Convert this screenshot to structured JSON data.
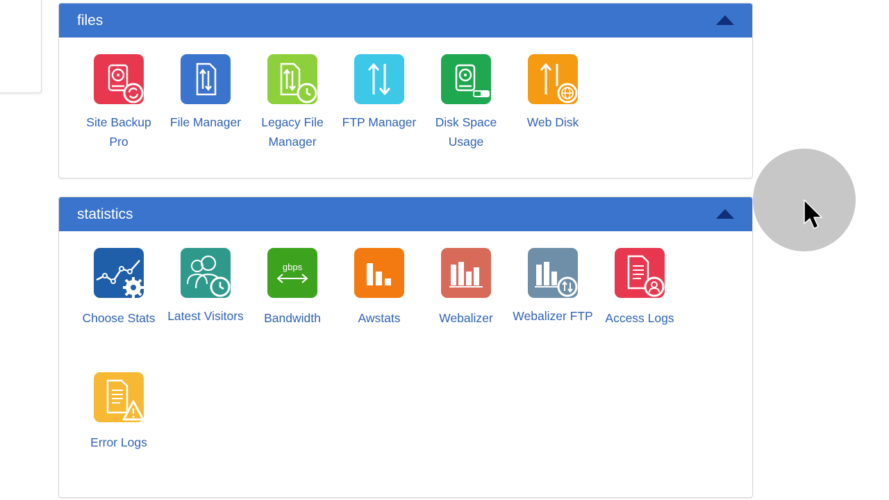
{
  "sections": [
    {
      "id": "files",
      "title": "files",
      "items": [
        {
          "label": "Site Backup Pro",
          "icon": "site-backup-icon",
          "color": "#e8384f"
        },
        {
          "label": "File Manager",
          "icon": "file-manager-icon",
          "color": "#3b74cc"
        },
        {
          "label": "Legacy File Manager",
          "icon": "legacy-file-manager-icon",
          "color": "#8ed03b"
        },
        {
          "label": "FTP Manager",
          "icon": "ftp-manager-icon",
          "color": "#3ec8e8"
        },
        {
          "label": "Disk Space Usage",
          "icon": "disk-space-icon",
          "color": "#1fa84f"
        },
        {
          "label": "Web Disk",
          "icon": "web-disk-icon",
          "color": "#f49a13"
        }
      ]
    },
    {
      "id": "statistics",
      "title": "statistics",
      "items": [
        {
          "label": "Choose Stats",
          "icon": "choose-stats-icon",
          "color": "#1f5ea8"
        },
        {
          "label": "Latest Visitors",
          "icon": "latest-visitors-icon",
          "color": "#2f9a8c"
        },
        {
          "label": "Bandwidth",
          "icon": "bandwidth-icon",
          "color": "#3da31f",
          "icon_text": "gbps"
        },
        {
          "label": "Awstats",
          "icon": "awstats-icon",
          "color": "#f27a10"
        },
        {
          "label": "Webalizer",
          "icon": "webalizer-icon",
          "color": "#d86a5a"
        },
        {
          "label": "Webalizer FTP",
          "icon": "webalizer-ftp-icon",
          "color": "#6f8ea8"
        },
        {
          "label": "Access Logs",
          "icon": "access-logs-icon",
          "color": "#e8384f"
        },
        {
          "label": "Error Logs",
          "icon": "error-logs-icon",
          "color": "#f7b933"
        }
      ]
    }
  ]
}
